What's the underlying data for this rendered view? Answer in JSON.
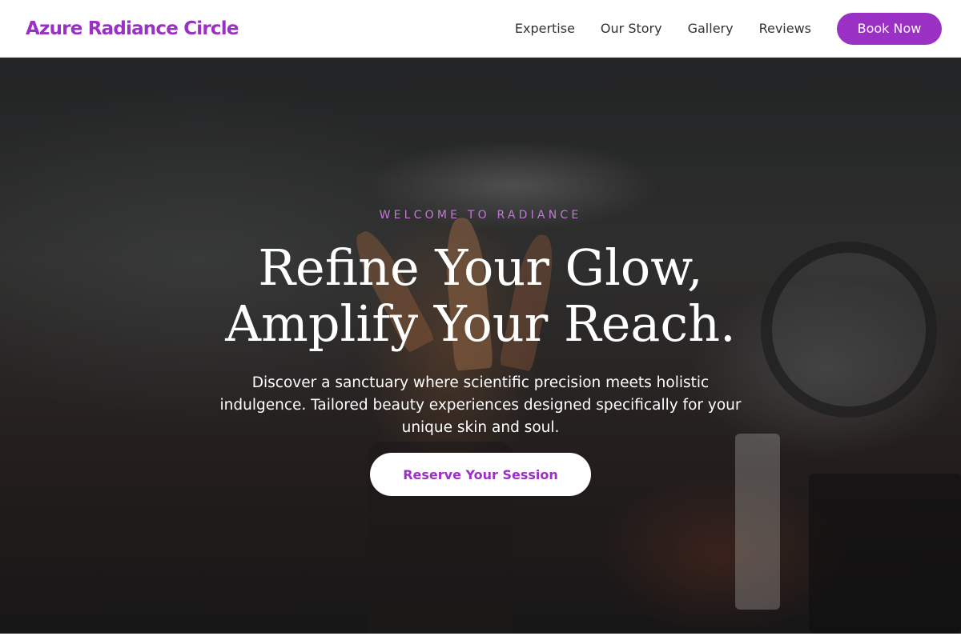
{
  "header": {
    "brand": "Azure Radiance Circle",
    "nav": [
      "Expertise",
      "Our Story",
      "Gallery",
      "Reviews"
    ],
    "book_label": "Book Now"
  },
  "hero": {
    "eyebrow": "WELCOME TO RADIANCE",
    "headline_line1": "Refine Your Glow,",
    "headline_line2": "Amplify Your Reach.",
    "subtext": "Discover a sanctuary where scientific precision meets holistic indulgence. Tailored beauty experiences designed specifically for your unique skin and soul.",
    "cta_label": "Reserve Your Session",
    "background_image": "makeup brushes and cosmetics on a vanity"
  },
  "colors": {
    "accent": "#9b30c4",
    "eyebrow": "#c277d6",
    "header_bg": "#ffffff",
    "text_light": "#ffffff"
  }
}
